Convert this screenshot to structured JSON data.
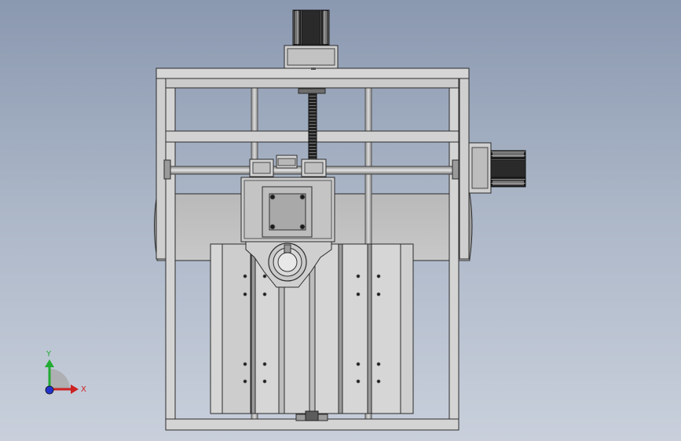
{
  "viewport": {
    "background_top": "#8a98b0",
    "background_bottom": "#c9d0dc",
    "part_fill": "#d2d2d2",
    "part_shade": "#a9a9a9",
    "part_dark": "#7e7e7e",
    "edge_color": "#2b2b2b",
    "motor_dark": "#1e1e1e"
  },
  "triad": {
    "x_label": "X",
    "y_label": "Y",
    "x_color": "#cc2222",
    "y_color": "#22aa33",
    "z_color": "#2233cc"
  },
  "model": {
    "components": [
      "top-stepper-motor",
      "right-stepper-motor",
      "frame",
      "lead-screw",
      "guide-rods",
      "horizontal-rail",
      "z-carriage",
      "spindle-clamp",
      "x-table"
    ]
  }
}
